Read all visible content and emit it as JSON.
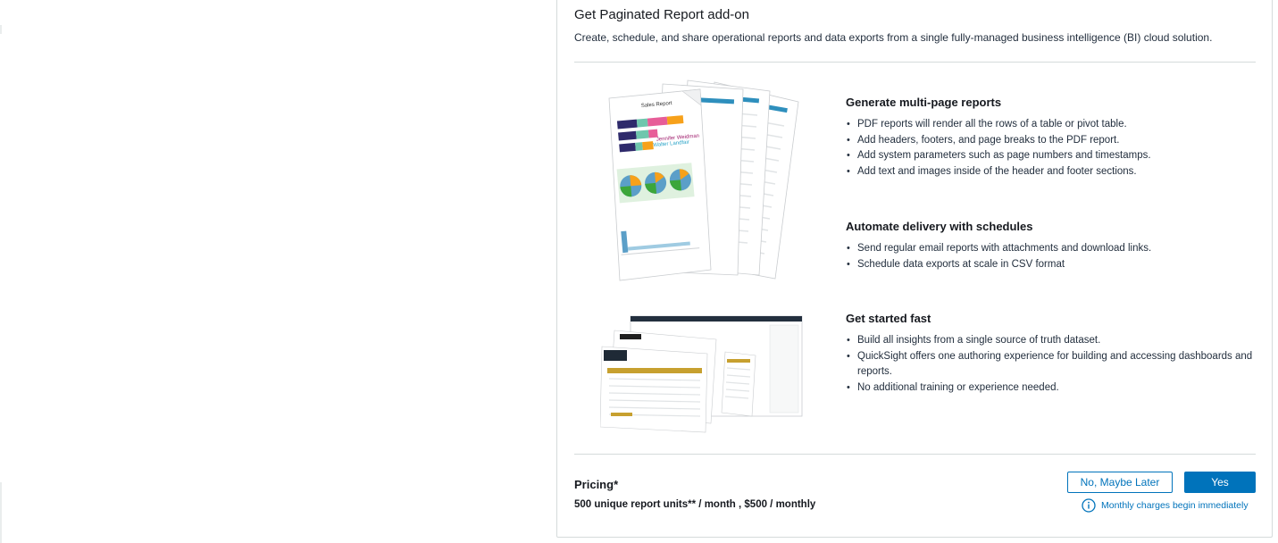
{
  "dialog": {
    "title": "Get Paginated Report add-on",
    "subtitle": "Create, schedule, and share operational reports and data exports from a single fully-managed business intelligence (BI) cloud solution."
  },
  "features": [
    {
      "heading": "Generate multi-page reports",
      "bullets": [
        "PDF reports will render all the rows of a table or pivot table.",
        "Add headers, footers, and page breaks to the PDF report.",
        "Add system parameters such as page numbers and timestamps.",
        "Add text and images inside of the header and footer sections."
      ]
    },
    {
      "heading": "Automate delivery with schedules",
      "bullets": [
        "Send regular email reports with attachments and download links.",
        "Schedule data exports at scale in CSV format"
      ]
    },
    {
      "heading": "Get started fast",
      "bullets": [
        "Build all insights from a single source of truth dataset.",
        "QuickSight offers one authoring experience for building and accessing dashboards and reports.",
        "No additional training or experience needed."
      ]
    }
  ],
  "illustration_1": {
    "report_title": "Sales Report",
    "name_1": "Jennifer Weidman",
    "name_2": "Walter Landfair"
  },
  "pricing": {
    "title": "Pricing*",
    "detail": "500 unique report units** / month , $500 / monthly"
  },
  "buttons": {
    "later": "No, Maybe Later",
    "yes": "Yes"
  },
  "notice": {
    "text": "Monthly charges begin immediately",
    "icon": "info-icon"
  },
  "colors": {
    "accent": "#0073bb",
    "text": "#16191f",
    "divider": "#d5dbdb"
  }
}
